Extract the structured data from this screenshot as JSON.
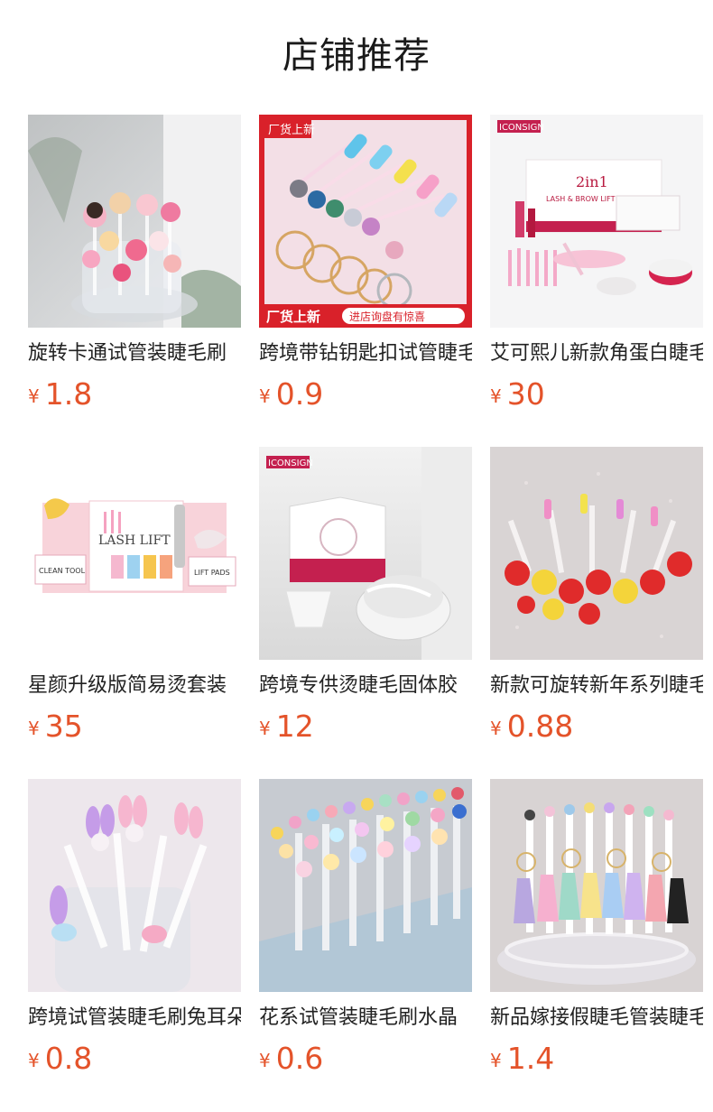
{
  "section_title": "店铺推荐",
  "products": [
    {
      "name": "旋转卡通试管装睫毛刷",
      "currency": "¥",
      "price": "1.8"
    },
    {
      "name": "跨境带钻钥匙扣试管睫毛刷",
      "currency": "¥",
      "price": "0.9",
      "badge": "厂货上新",
      "banner_tag": "厂货上新",
      "banner_text": "进店询盘有惊喜"
    },
    {
      "name": "艾可熙儿新款角蛋白睫毛",
      "currency": "¥",
      "price": "30",
      "brand": "ICONSIGN",
      "box_text": "2in1",
      "box_subtext": "LASH & BROW LIFT KIT"
    },
    {
      "name": "星颜升级版简易烫套装",
      "currency": "¥",
      "price": "35",
      "box_text": "LASH LIFT",
      "card_left": "CLEAN TOOL",
      "card_right": "LIFT PADS"
    },
    {
      "name": "跨境专供烫睫毛固体胶",
      "currency": "¥",
      "price": "12",
      "brand": "ICONSIGN"
    },
    {
      "name": "新款可旋转新年系列睫毛刷",
      "currency": "¥",
      "price": "0.88"
    },
    {
      "name": "跨境试管装睫毛刷兔耳朵",
      "currency": "¥",
      "price": "0.8"
    },
    {
      "name": "花系试管装睫毛刷水晶",
      "currency": "¥",
      "price": "0.6"
    },
    {
      "name": "新品嫁接假睫毛管装睫毛刷",
      "currency": "¥",
      "price": "1.4"
    }
  ],
  "colors": {
    "price": "#e4532a",
    "badge_red": "#d9212a"
  }
}
